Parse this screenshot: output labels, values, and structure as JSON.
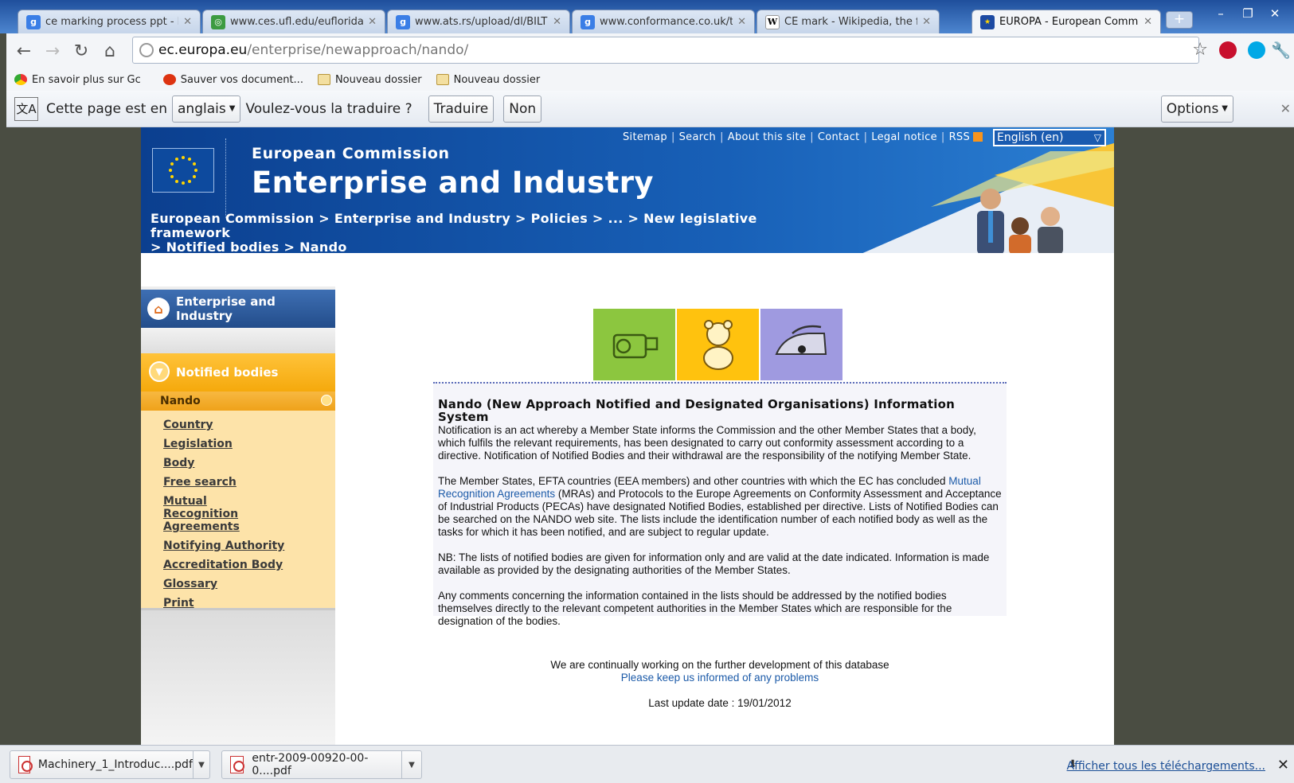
{
  "browser": {
    "tabs": [
      {
        "title": "ce marking process ppt - Rech",
        "icon": "google-favicon"
      },
      {
        "title": "www.ces.ufl.edu/euflorida/d",
        "icon": "globe-favicon"
      },
      {
        "title": "www.ats.rs/upload/dl/BILTEN",
        "icon": "google-favicon"
      },
      {
        "title": "www.conformance.co.uk/tra",
        "icon": "google-favicon"
      },
      {
        "title": "CE mark - Wikipedia, the free",
        "icon": "wikipedia-favicon"
      },
      {
        "title": "EUROPA - European Commiss",
        "icon": "eu-flag-favicon"
      }
    ],
    "url_host": "ec.europa.eu",
    "url_path": "/enterprise/newapproach/nando/",
    "bookmarks": [
      {
        "label": "En savoir plus sur Gc"
      },
      {
        "label": "Sauver vos document..."
      },
      {
        "label": "Nouveau dossier"
      },
      {
        "label": "Nouveau dossier"
      }
    ],
    "translate": {
      "prefix": "Cette page est en",
      "language": "anglais",
      "question": "Voulez-vous la traduire ?",
      "translate_btn": "Traduire",
      "no_btn": "Non",
      "options_btn": "Options"
    }
  },
  "site": {
    "utility_links": [
      "Sitemap",
      "Search",
      "About this site",
      "Contact",
      "Legal notice",
      "RSS"
    ],
    "language_select": "English (en)",
    "org_name": "European Commission",
    "dg_name": "Enterprise and Industry",
    "breadcrumb_line1": "European Commission  > Enterprise and Industry  > Policies  > ...  > New legislative framework",
    "breadcrumb_line2": " > Notified bodies  > Nando"
  },
  "sidebar": {
    "home": "Enterprise and Industry",
    "section": "Notified bodies",
    "subsection": "Nando",
    "links": [
      "Country",
      "Legislation",
      "Body",
      "Free search",
      "Mutual Recognition Agreements",
      "Notifying Authority",
      "Accreditation Body",
      "Glossary",
      "Print"
    ]
  },
  "content": {
    "heading": "Nando (New Approach Notified and Designated Organisations) Information System",
    "p1": "Notification is an act whereby a Member State informs the Commission and the other Member States that a body, which fulfils the relevant requirements, has been designated to carry out conformity assessment according to a directive. Notification of Notified Bodies and their withdrawal are the responsibility of the notifying Member State.",
    "p2_before": "The Member States, EFTA countries (EEA members) and other countries with which the EC has concluded ",
    "p2_link": "Mutual Recognition Agreements",
    "p2_after": " (MRAs) and Protocols to the Europe Agreements on Conformity Assessment and Acceptance of Industrial Products (PECAs) have designated Notified Bodies, established per directive. Lists of Notified Bodies can be searched on the NANDO web site. The lists include the identification number of each notified body as well as the tasks for which it has been notified, and are subject to regular update.",
    "p3": "NB: The lists of notified bodies are given for information only and are valid at the date indicated. Information is made available as provided by the designating authorities of the Member States.",
    "p4": "Any comments concerning the information contained in the lists should be addressed by the notified bodies themselves directly to the relevant competent authorities in the Member States which are responsible for the designation of the bodies.",
    "dev_note": "We are continually working on the further development of this database",
    "problems_link": "Please keep us informed of any problems",
    "last_update": "Last update date : 19/01/2012"
  },
  "downloads": {
    "items": [
      {
        "name": "Machinery_1_Introduc....pdf"
      },
      {
        "name": "entr-2009-00920-00-0....pdf"
      }
    ],
    "show_all": "Afficher tous les téléchargements..."
  },
  "colors": {
    "banner_blue": "#1860b7",
    "sidebar_orange": "#f5a90c",
    "sidebar_cream": "#fde3a9",
    "link_blue": "#1b5aa8"
  }
}
